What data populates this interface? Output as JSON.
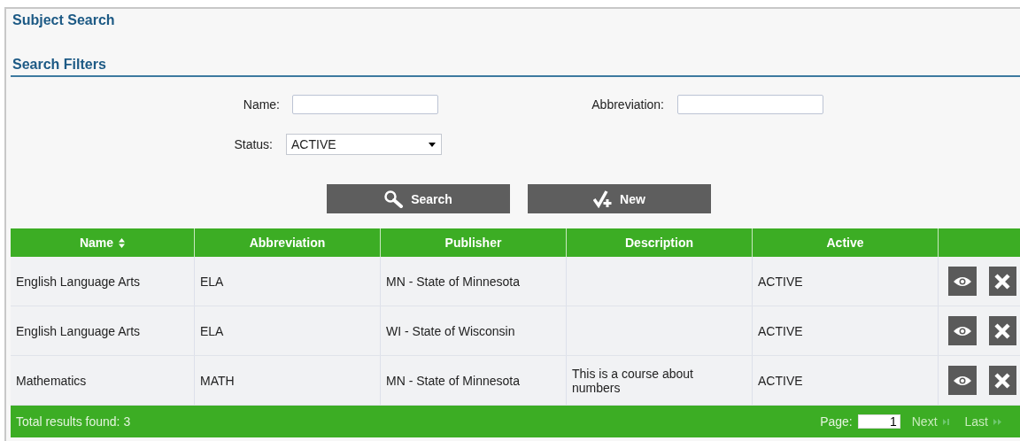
{
  "title": "Subject Search",
  "filters": {
    "heading": "Search Filters",
    "name_label": "Name:",
    "abbreviation_label": "Abbreviation:",
    "status_label": "Status:",
    "status_value": "ACTIVE"
  },
  "buttons": [
    {
      "kind": "search",
      "label": "Search"
    },
    {
      "kind": "new",
      "label": "New"
    }
  ],
  "table": {
    "columns": [
      {
        "label": "Name",
        "sortable": true
      },
      {
        "label": "Abbreviation",
        "sortable": false
      },
      {
        "label": "Publisher",
        "sortable": false
      },
      {
        "label": "Description",
        "sortable": false
      },
      {
        "label": "Active",
        "sortable": false
      }
    ],
    "rows": [
      [
        "English Language Arts",
        "ELA",
        "MN - State of Minnesota",
        "",
        "ACTIVE"
      ],
      [
        "English Language Arts",
        "ELA",
        "WI - State of Wisconsin",
        "",
        "ACTIVE"
      ],
      [
        "Mathematics",
        "MATH",
        "MN - State of Minnesota",
        "This is a course about numbers",
        "ACTIVE"
      ]
    ]
  },
  "footer": {
    "total": "Total results found: 3",
    "page_label": "Page:",
    "page_value": "1",
    "next": "Next",
    "last": "Last"
  }
}
